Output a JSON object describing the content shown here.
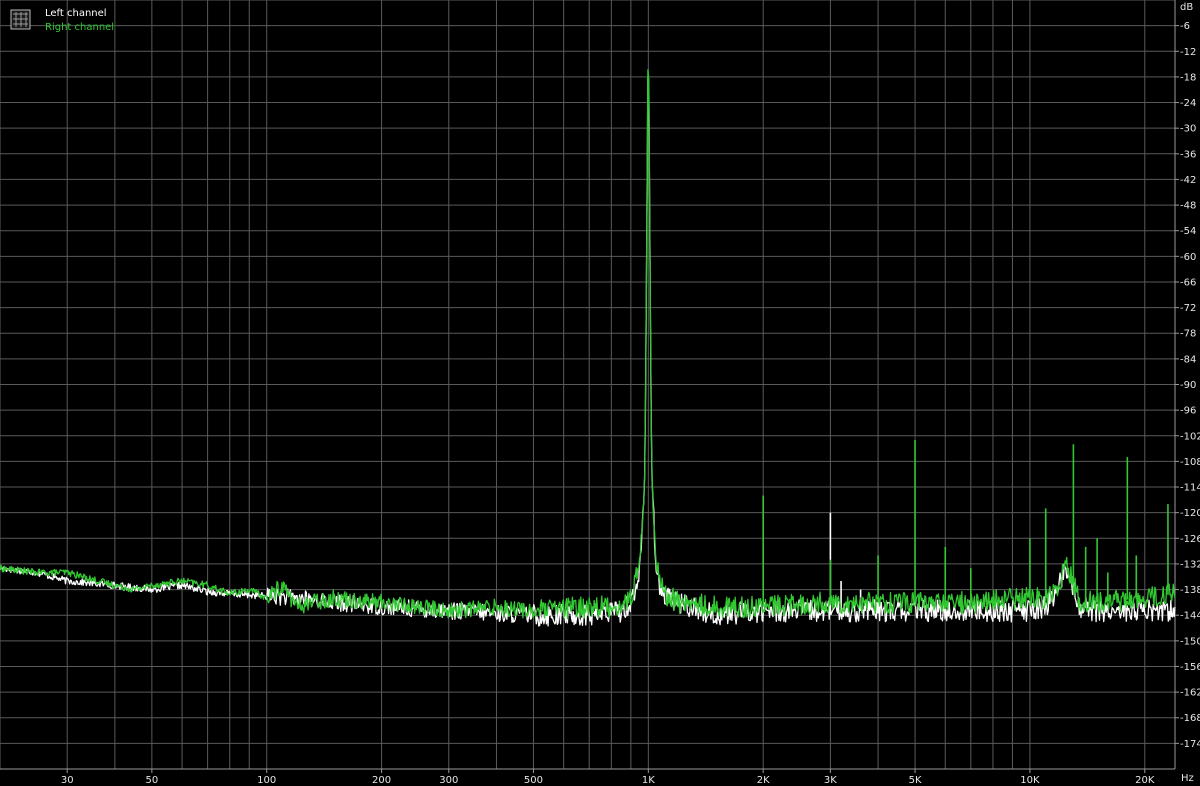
{
  "chart_data": {
    "type": "line",
    "xscale": "log",
    "xlim": [
      20,
      24000
    ],
    "ylim": [
      -180,
      0
    ],
    "grid": true,
    "legend_position": "top-left",
    "y_unit": "dB",
    "x_unit": "Hz",
    "y_ticks": [
      -6,
      -12,
      -18,
      -24,
      -30,
      -36,
      -42,
      -48,
      -54,
      -60,
      -66,
      -72,
      -78,
      -84,
      -90,
      -96,
      -102,
      -108,
      -114,
      -120,
      -126,
      -132,
      -138,
      -144,
      -150,
      -156,
      -162,
      -168,
      -174
    ],
    "x_ticks": [
      {
        "value": 30,
        "label": "30"
      },
      {
        "value": 50,
        "label": "50"
      },
      {
        "value": 100,
        "label": "100"
      },
      {
        "value": 200,
        "label": "200"
      },
      {
        "value": 300,
        "label": "300"
      },
      {
        "value": 500,
        "label": "500"
      },
      {
        "value": 1000,
        "label": "1K"
      },
      {
        "value": 2000,
        "label": "2K"
      },
      {
        "value": 3000,
        "label": "3K"
      },
      {
        "value": 5000,
        "label": "5K"
      },
      {
        "value": 10000,
        "label": "10K"
      },
      {
        "value": 20000,
        "label": "20K"
      }
    ],
    "series": [
      {
        "name": "Left channel",
        "color": "#ffffff",
        "x": [
          20,
          25,
          30,
          40,
          50,
          60,
          70,
          80,
          100,
          120,
          150,
          200,
          300,
          500,
          700,
          850,
          900,
          950,
          980,
          1000,
          1020,
          1050,
          1100,
          1200,
          1500,
          2000,
          3000,
          4000,
          5000,
          7000,
          10000,
          11000,
          11800,
          12500,
          13500,
          15000,
          20000,
          24000
        ],
        "y": [
          -133,
          -134,
          -136,
          -137,
          -138,
          -137,
          -138.5,
          -139,
          -139.5,
          -140,
          -141,
          -142,
          -143,
          -144,
          -144,
          -143,
          -141,
          -134,
          -110,
          -6,
          -110,
          -134,
          -140,
          -141,
          -144,
          -143,
          -143,
          -143,
          -143,
          -143,
          -143,
          -142,
          -138,
          -133,
          -142,
          -143,
          -143,
          -143
        ],
        "peaks": [
          {
            "x": 3000,
            "y": -120
          },
          {
            "x": 3200,
            "y": -136
          },
          {
            "x": 3600,
            "y": -138
          }
        ]
      },
      {
        "name": "Right channel",
        "color": "#32c832",
        "x": [
          20,
          25,
          30,
          40,
          45,
          50,
          60,
          70,
          80,
          90,
          100,
          110,
          120,
          130,
          150,
          200,
          250,
          300,
          400,
          500,
          700,
          850,
          900,
          950,
          980,
          1000,
          1020,
          1050,
          1100,
          1200,
          1500,
          2000,
          3000,
          4000,
          5000,
          7000,
          10000,
          11000,
          11800,
          12500,
          13500,
          15000,
          20000,
          24000
        ],
        "y": [
          -133,
          -134,
          -134,
          -137,
          -138,
          -137,
          -136,
          -137,
          -139,
          -138,
          -140,
          -137,
          -142,
          -141,
          -140,
          -141,
          -142,
          -143,
          -142,
          -143,
          -142,
          -142,
          -140,
          -132,
          -110,
          -4,
          -110,
          -132,
          -139,
          -141,
          -142,
          -142,
          -141,
          -141,
          -141,
          -141,
          -140,
          -140,
          -137,
          -132,
          -141,
          -141,
          -140,
          -139
        ],
        "peaks": [
          {
            "x": 2000,
            "y": -116
          },
          {
            "x": 3000,
            "y": -131
          },
          {
            "x": 4000,
            "y": -130
          },
          {
            "x": 5000,
            "y": -103
          },
          {
            "x": 6000,
            "y": -128
          },
          {
            "x": 7000,
            "y": -133
          },
          {
            "x": 10000,
            "y": -126
          },
          {
            "x": 11000,
            "y": -119
          },
          {
            "x": 13000,
            "y": -104
          },
          {
            "x": 14000,
            "y": -128
          },
          {
            "x": 15000,
            "y": -126
          },
          {
            "x": 16000,
            "y": -134
          },
          {
            "x": 18000,
            "y": -107
          },
          {
            "x": 19000,
            "y": -130
          },
          {
            "x": 23000,
            "y": -118
          }
        ]
      }
    ]
  }
}
